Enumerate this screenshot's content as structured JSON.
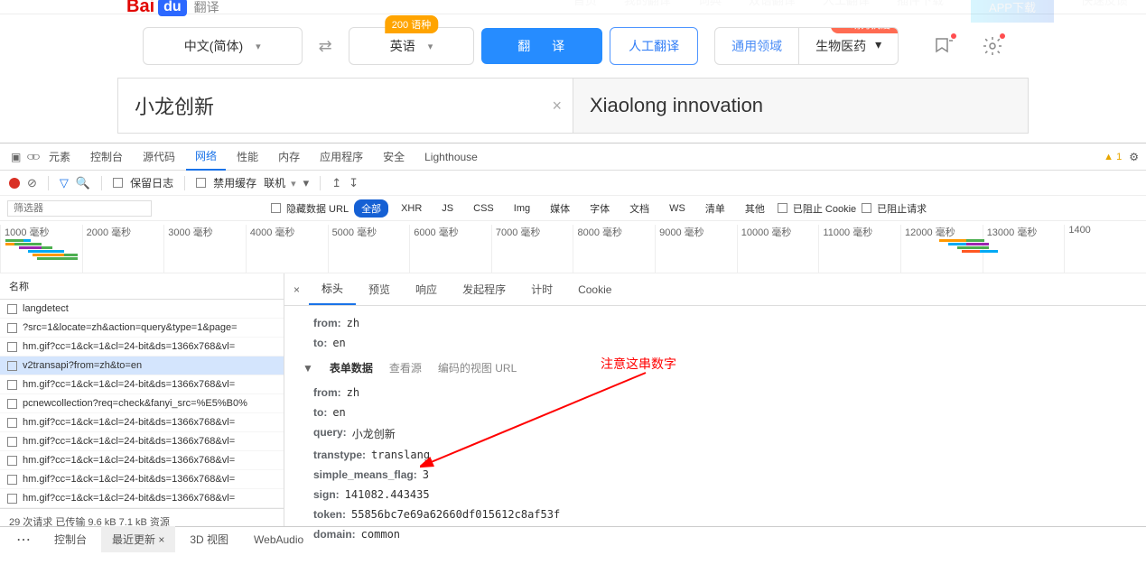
{
  "logo": {
    "bai": "Bai",
    "du": "du",
    "fy": "翻译"
  },
  "topnav": [
    "首页",
    "我的翻译",
    "词典",
    "双语翻译",
    "人工翻译",
    "",
    "插件下载"
  ],
  "download_btn": "APP下载",
  "right_nav": "快速反馈",
  "lang_from": "中文(简体)",
  "lang_to": "英语",
  "badge_200": "200 语种",
  "badge_covid": "助力抗疫",
  "translate_btn": "翻 译",
  "human_btn": "人工翻译",
  "domain": {
    "general": "通用领域",
    "bio": "生物医药"
  },
  "input_text": "小龙创新",
  "output_text": "Xiaolong innovation",
  "devtools": {
    "tabs": [
      "元素",
      "控制台",
      "源代码",
      "网络",
      "性能",
      "内存",
      "应用程序",
      "安全",
      "Lighthouse"
    ],
    "active_tab": "网络",
    "warn_count": "▲ 1",
    "toolbar": {
      "preserve_log": "保留日志",
      "disable_cache": "禁用缓存",
      "online": "联机"
    },
    "filter": {
      "placeholder": "筛选器",
      "hide_data": "隐藏数据 URL",
      "types": [
        "全部",
        "XHR",
        "JS",
        "CSS",
        "Img",
        "媒体",
        "字体",
        "文档",
        "WS",
        "清单",
        "其他"
      ],
      "active_type": "全部",
      "blocked_cookies": "已阻止 Cookie",
      "blocked_reqs": "已阻止请求"
    },
    "timeline_ticks": [
      "1000 毫秒",
      "2000 毫秒",
      "3000 毫秒",
      "4000 毫秒",
      "5000 毫秒",
      "6000 毫秒",
      "7000 毫秒",
      "8000 毫秒",
      "9000 毫秒",
      "10000 毫秒",
      "11000 毫秒",
      "12000 毫秒",
      "13000 毫秒",
      "1400"
    ],
    "req_header": "名称",
    "requests": [
      "langdetect",
      "?src=1&locate=zh&action=query&type=1&page=",
      "hm.gif?cc=1&ck=1&cl=24-bit&ds=1366x768&vl=",
      "v2transapi?from=zh&to=en",
      "hm.gif?cc=1&ck=1&cl=24-bit&ds=1366x768&vl=",
      "pcnewcollection?req=check&fanyi_src=%E5%B0%",
      "hm.gif?cc=1&ck=1&cl=24-bit&ds=1366x768&vl=",
      "hm.gif?cc=1&ck=1&cl=24-bit&ds=1366x768&vl=",
      "hm.gif?cc=1&ck=1&cl=24-bit&ds=1366x768&vl=",
      "hm.gif?cc=1&ck=1&cl=24-bit&ds=1366x768&vl=",
      "hm.gif?cc=1&ck=1&cl=24-bit&ds=1366x768&vl="
    ],
    "selected_req_idx": 3,
    "req_footer": "29 次请求  已传输 9.6 kB  7.1 kB 资源",
    "detail": {
      "tabs": [
        "标头",
        "预览",
        "响应",
        "发起程序",
        "计时",
        "Cookie"
      ],
      "active": "标头",
      "top_kv": [
        {
          "k": "from:",
          "v": "zh"
        },
        {
          "k": "to:",
          "v": "en"
        }
      ],
      "section": {
        "title": "表单数据",
        "view_source": "查看源",
        "view_encoded": "编码的视图 URL"
      },
      "form_kv": [
        {
          "k": "from:",
          "v": "zh"
        },
        {
          "k": "to:",
          "v": "en"
        },
        {
          "k": "query:",
          "v": "小龙创新"
        },
        {
          "k": "transtype:",
          "v": "translang"
        },
        {
          "k": "simple_means_flag:",
          "v": "3"
        },
        {
          "k": "sign:",
          "v": "141082.443435"
        },
        {
          "k": "token:",
          "v": "55856bc7e69a62660df015612c8af53f"
        },
        {
          "k": "domain:",
          "v": "common"
        }
      ]
    },
    "annotation_text": "注意这串数字"
  },
  "bottom_tabs": [
    "控制台",
    "最近更新 ×",
    "3D 视图",
    "WebAudio"
  ]
}
